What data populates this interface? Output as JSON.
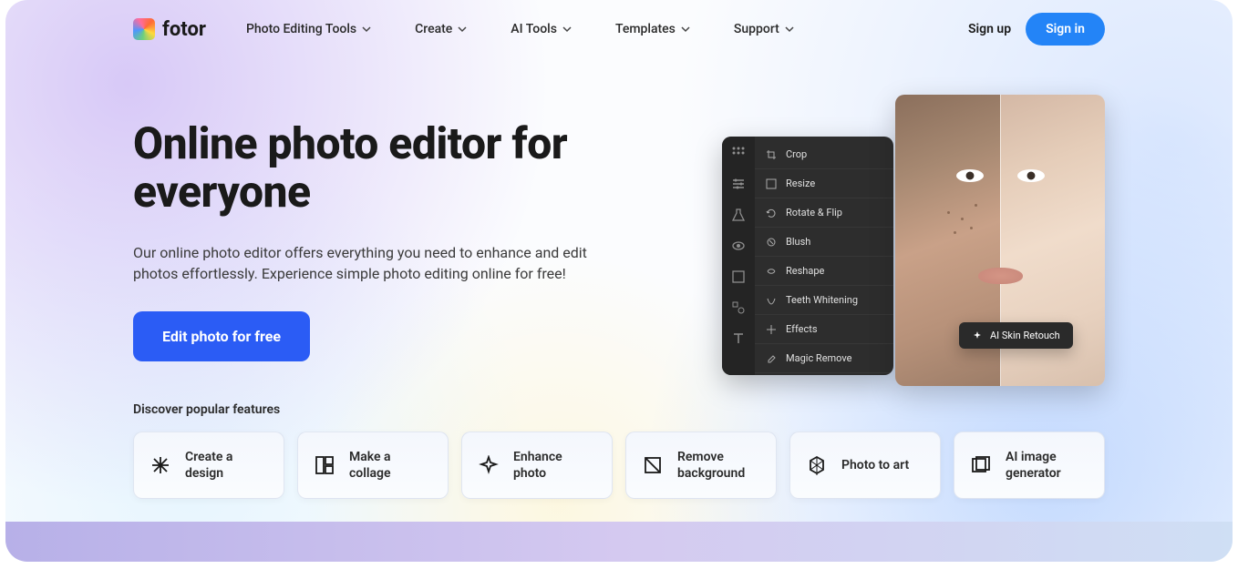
{
  "brand": {
    "name": "fotor"
  },
  "nav": {
    "items": [
      {
        "label": "Photo Editing Tools"
      },
      {
        "label": "Create"
      },
      {
        "label": "AI Tools"
      },
      {
        "label": "Templates"
      },
      {
        "label": "Support"
      }
    ]
  },
  "auth": {
    "signup": "Sign up",
    "signin": "Sign in"
  },
  "hero": {
    "title": "Online photo editor for everyone",
    "subtitle": "Our online photo editor offers everything you need to enhance and edit photos effortlessly. Experience simple photo editing online for free!",
    "cta": "Edit photo for free"
  },
  "editor_menu": {
    "items": [
      {
        "label": "Crop"
      },
      {
        "label": "Resize"
      },
      {
        "label": "Rotate & Flip"
      },
      {
        "label": "Blush"
      },
      {
        "label": "Reshape"
      },
      {
        "label": "Teeth Whitening"
      },
      {
        "label": "Effects"
      },
      {
        "label": "Magic Remove"
      }
    ]
  },
  "badge": {
    "label": "AI Skin Retouch"
  },
  "features": {
    "title": "Discover popular features",
    "items": [
      {
        "label": "Create a design"
      },
      {
        "label": "Make a collage"
      },
      {
        "label": "Enhance photo"
      },
      {
        "label": "Remove background"
      },
      {
        "label": "Photo to art"
      },
      {
        "label": "AI image generator"
      }
    ]
  }
}
